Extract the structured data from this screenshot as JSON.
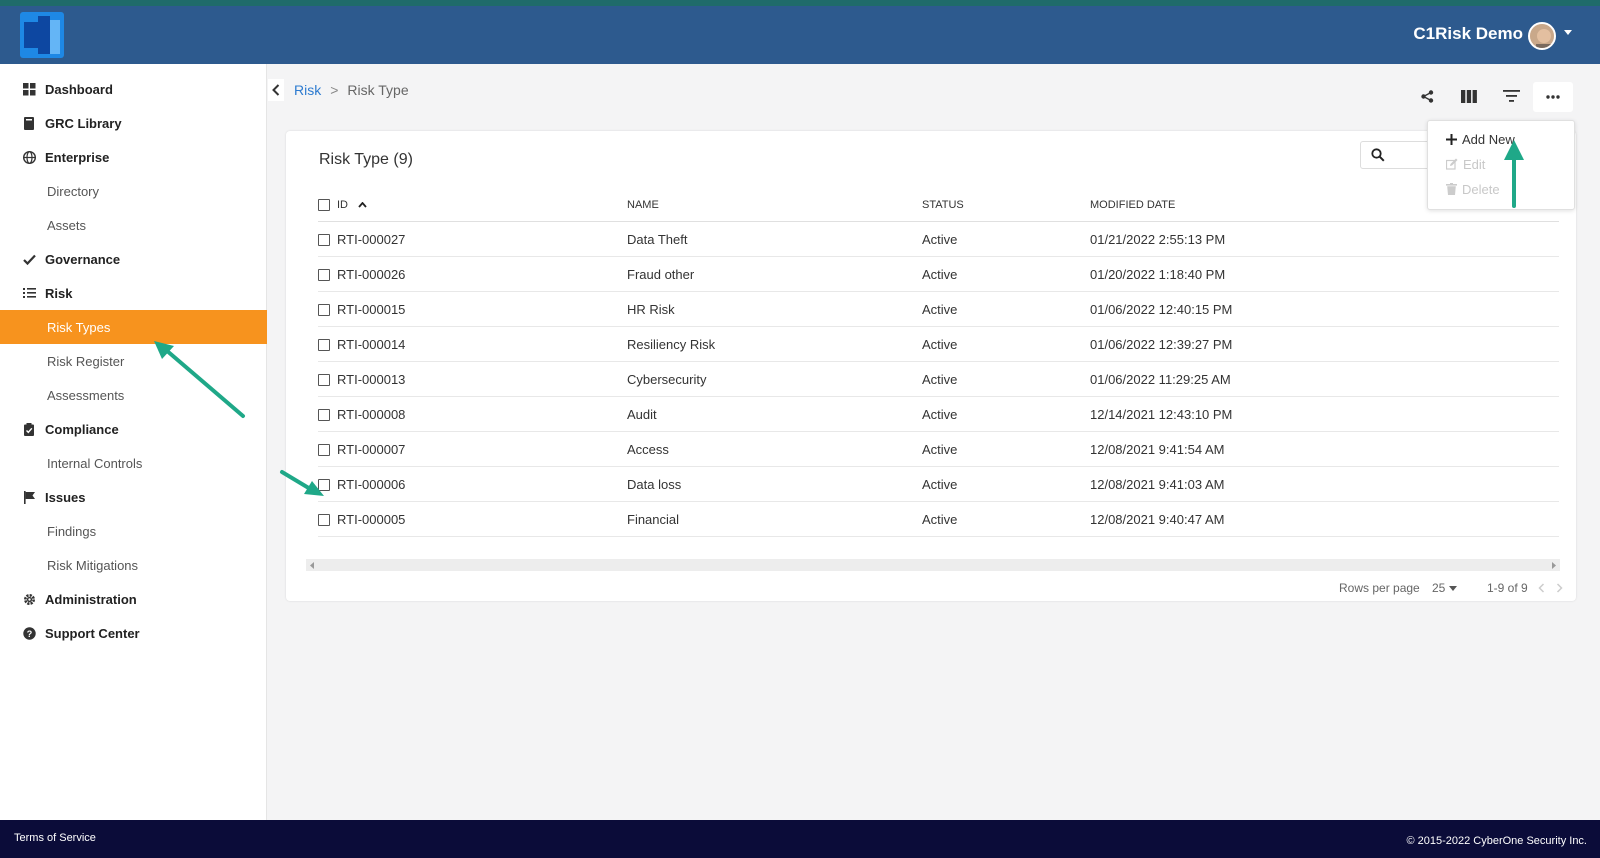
{
  "header": {
    "user_name": "C1Risk Demo"
  },
  "sidebar": {
    "items": [
      {
        "label": "Dashboard",
        "icon": "grid-icon",
        "level": "parent"
      },
      {
        "label": "GRC Library",
        "icon": "book-icon",
        "level": "parent"
      },
      {
        "label": "Enterprise",
        "icon": "globe-icon",
        "level": "parent"
      },
      {
        "label": "Directory",
        "level": "child"
      },
      {
        "label": "Assets",
        "level": "child"
      },
      {
        "label": "Governance",
        "icon": "check-icon",
        "level": "parent"
      },
      {
        "label": "Risk",
        "icon": "list-icon",
        "level": "parent"
      },
      {
        "label": "Risk Types",
        "level": "child",
        "active": true
      },
      {
        "label": "Risk Register",
        "level": "child"
      },
      {
        "label": "Assessments",
        "level": "child"
      },
      {
        "label": "Compliance",
        "icon": "clipboard-icon",
        "level": "parent"
      },
      {
        "label": "Internal Controls",
        "level": "child"
      },
      {
        "label": "Issues",
        "icon": "flag-icon",
        "level": "parent"
      },
      {
        "label": "Findings",
        "level": "child"
      },
      {
        "label": "Risk Mitigations",
        "level": "child"
      },
      {
        "label": "Administration",
        "icon": "gear-icon",
        "level": "parent"
      },
      {
        "label": "Support Center",
        "icon": "help-circle-icon",
        "level": "parent"
      }
    ]
  },
  "breadcrumb": {
    "parent": "Risk",
    "separator": ">",
    "current": "Risk Type"
  },
  "toolbar": {
    "icons": [
      "share-icon",
      "columns-icon",
      "filter-icon",
      "more-horizontal-icon"
    ]
  },
  "card": {
    "title": "Risk Type (9)"
  },
  "table": {
    "columns": [
      "ID",
      "NAME",
      "STATUS",
      "MODIFIED DATE"
    ],
    "rows": [
      {
        "id": "RTI-000027",
        "name": "Data Theft",
        "status": "Active",
        "modified": "01/21/2022 2:55:13 PM"
      },
      {
        "id": "RTI-000026",
        "name": "Fraud other",
        "status": "Active",
        "modified": "01/20/2022 1:18:40 PM"
      },
      {
        "id": "RTI-000015",
        "name": "HR Risk",
        "status": "Active",
        "modified": "01/06/2022 12:40:15 PM"
      },
      {
        "id": "RTI-000014",
        "name": "Resiliency Risk",
        "status": "Active",
        "modified": "01/06/2022 12:39:27 PM"
      },
      {
        "id": "RTI-000013",
        "name": "Cybersecurity",
        "status": "Active",
        "modified": "01/06/2022 11:29:25 AM"
      },
      {
        "id": "RTI-000008",
        "name": "Audit",
        "status": "Active",
        "modified": "12/14/2021 12:43:10 PM"
      },
      {
        "id": "RTI-000007",
        "name": "Access",
        "status": "Active",
        "modified": "12/08/2021 9:41:54 AM"
      },
      {
        "id": "RTI-000006",
        "name": "Data loss",
        "status": "Active",
        "modified": "12/08/2021 9:41:03 AM"
      },
      {
        "id": "RTI-000005",
        "name": "Financial",
        "status": "Active",
        "modified": "12/08/2021 9:40:47 AM"
      }
    ]
  },
  "pagination": {
    "rows_per_page_label": "Rows per page",
    "rows_per_page": "25",
    "range": "1-9 of 9"
  },
  "menu": {
    "add_new": "Add New",
    "edit": "Edit",
    "delete": "Delete"
  },
  "footer": {
    "terms": "Terms of Service",
    "copyright": "© 2015-2022 CyberOne Security Inc."
  },
  "colors": {
    "header": "#2d5a8e",
    "accent": "#f7931e",
    "link": "#2d7bd0",
    "annotation_arrow": "#1fa888",
    "footer": "#0b0c39"
  }
}
